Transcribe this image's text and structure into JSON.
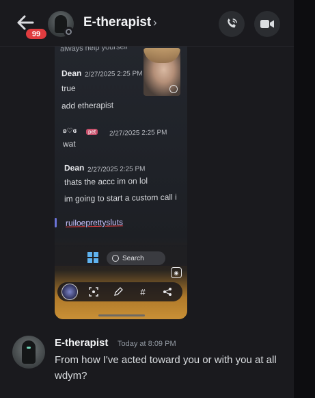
{
  "header": {
    "title": "E-therapist",
    "unread_badge": "99",
    "back_icon": "arrow-left-icon",
    "chevron": "›",
    "actions": [
      {
        "name": "voice-call",
        "icon": "phone-icon"
      },
      {
        "name": "video-call",
        "icon": "video-camera-icon"
      }
    ]
  },
  "attachment": {
    "cut_off_text": "always help yourself",
    "messages": [
      {
        "author": "Dean",
        "time": "2/27/2025 2:25 PM",
        "lines": [
          "true",
          "add etherapist"
        ]
      },
      {
        "author": "ʚ♡ɞ",
        "tag": "pet",
        "time": "2/27/2025 2:25 PM",
        "lines": [
          "wat"
        ]
      },
      {
        "author": "Dean",
        "time": "2/27/2025 2:25 PM",
        "lines": [
          "thats the accc im on lol",
          "im going to start a custom call i"
        ]
      }
    ],
    "link_text": "ruiloeprettysluts",
    "taskbar_search": "Search",
    "toolbar_icons": [
      "thumbnail",
      "screenshot-icon",
      "edit-icon",
      "hash-icon",
      "share-icon"
    ]
  },
  "message": {
    "author": "E-therapist",
    "timestamp": "Today at 8:09 PM",
    "text": "From how I've acted toward you or with you at all wdym?"
  },
  "colors": {
    "background": "#1a1a1e",
    "badge": "#e03c3f",
    "text": "#dbdee1",
    "muted": "#949ba4"
  }
}
